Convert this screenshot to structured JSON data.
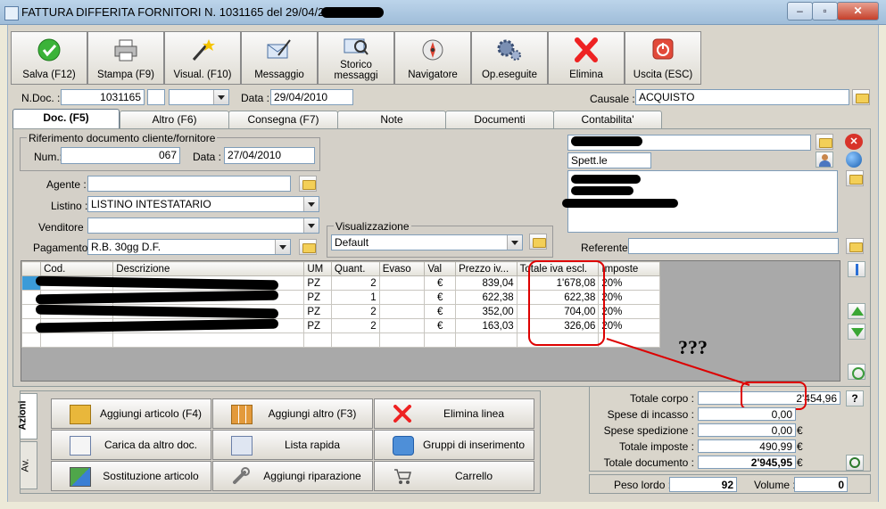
{
  "window": {
    "title": "FATTURA DIFFERITA FORNITORI N. 1031165  del 29/04/2010  - AI"
  },
  "window_controls": {
    "minimize": "‒",
    "maximize": "▫",
    "close": "✕"
  },
  "toolbar": {
    "buttons": [
      {
        "label": "Salva (F12)",
        "icon": "save-check-icon"
      },
      {
        "label": "Stampa (F9)",
        "icon": "printer-icon"
      },
      {
        "label": "Visual. (F10)",
        "icon": "magic-wand-icon"
      },
      {
        "label": "Messaggio",
        "icon": "message-pen-icon"
      },
      {
        "label": "Storico messaggi",
        "icon": "message-history-icon"
      },
      {
        "label": "Navigatore",
        "icon": "compass-icon"
      },
      {
        "label": "Op.eseguite",
        "icon": "gears-icon"
      },
      {
        "label": "Elimina",
        "icon": "delete-x-icon"
      },
      {
        "label": "Uscita (ESC)",
        "icon": "exit-power-icon"
      }
    ]
  },
  "header": {
    "ndoc_label": "N.Doc. :",
    "ndoc_value": "1031165",
    "data_label": "Data :",
    "data_value": "29/04/2010",
    "causale_label": "Causale :",
    "causale_value": "ACQUISTO"
  },
  "tabs": [
    "Doc. (F5)",
    "Altro (F6)",
    "Consegna (F7)",
    "Note",
    "Documenti",
    "Contabilita'"
  ],
  "riferimento": {
    "title": "Riferimento documento cliente/fornitore",
    "num_label": "Num.:",
    "num_value": "067",
    "data_label": "Data :",
    "data_value": "27/04/2010"
  },
  "form": {
    "agente_label": "Agente :",
    "agente_value": "",
    "listino_label": "Listino :",
    "listino_value": "LISTINO INTESTATARIO",
    "venditore_label": "Venditore :",
    "venditore_value": "",
    "pagamento_label": "Pagamento :",
    "pagamento_value": "R.B. 30gg D.F.",
    "visualizzazione_title": "Visualizzazione",
    "visualizzazione_value": "Default"
  },
  "anagrafica": {
    "spett": "Spett.le",
    "referente_label": "Referente"
  },
  "grid": {
    "columns": [
      "Cod.",
      "Descrizione",
      "UM",
      "Quant.",
      "Evaso",
      "Val",
      "Prezzo iv...",
      "Totale iva escl.",
      "Imposte"
    ],
    "rows": [
      {
        "um": "PZ",
        "quant": "2",
        "val": "€",
        "prezzo": "839,04",
        "totale": "1'678,08",
        "imposte": "20%"
      },
      {
        "um": "PZ",
        "quant": "1",
        "val": "€",
        "prezzo": "622,38",
        "totale": "622,38",
        "imposte": "20%"
      },
      {
        "um": "PZ",
        "quant": "2",
        "val": "€",
        "prezzo": "352,00",
        "totale": "704,00",
        "imposte": "20%"
      },
      {
        "um": "PZ",
        "quant": "2",
        "val": "€",
        "prezzo": "163,03",
        "totale": "326,06",
        "imposte": "20%"
      }
    ]
  },
  "annotation": {
    "text": "???",
    "color": "#dd0000"
  },
  "azioni": {
    "tab_azioni": "Azioni",
    "tab_av": "Av.",
    "buttons": [
      {
        "label": "Aggiungi articolo (F4)",
        "icon": "add-article-icon"
      },
      {
        "label": "Aggiungi altro (F3)",
        "icon": "add-other-icon"
      },
      {
        "label": "Elimina linea",
        "icon": "delete-line-icon"
      },
      {
        "label": "Carica da altro doc.",
        "icon": "load-doc-icon"
      },
      {
        "label": "Lista rapida",
        "icon": "quick-list-icon"
      },
      {
        "label": "Gruppi di inserimento",
        "icon": "insert-groups-icon"
      },
      {
        "label": "Sostituzione articolo",
        "icon": "replace-article-icon"
      },
      {
        "label": "Aggiungi riparazione",
        "icon": "wrench-icon"
      },
      {
        "label": "Carrello",
        "icon": "cart-icon"
      }
    ]
  },
  "totals": {
    "totale_corpo_label": "Totale corpo :",
    "totale_corpo": "2'454,96",
    "help": "?",
    "spese_incasso_label": "Spese di incasso :",
    "spese_incasso": "0,00",
    "spese_spedizione_label": "Spese spedizione :",
    "spese_spedizione": "0,00",
    "spese_spedizione_cur": "€",
    "totale_imposte_label": "Totale imposte :",
    "totale_imposte": "490,99",
    "totale_imposte_cur": "€",
    "totale_documento_label": "Totale documento :",
    "totale_documento": "2'945,95",
    "totale_documento_cur": "€",
    "peso_label": "Peso lordo :",
    "peso": "92",
    "volume_label": "Volume :",
    "volume": "0"
  }
}
